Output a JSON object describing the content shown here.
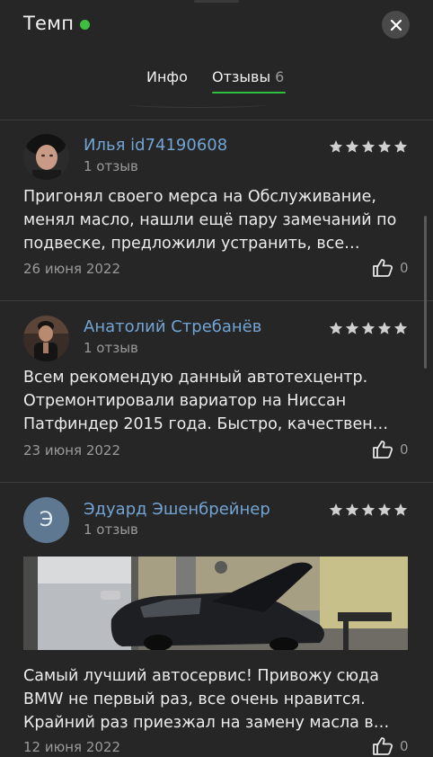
{
  "header": {
    "title": "Темп",
    "online_color": "#3fbf3f",
    "close_icon": "close-icon"
  },
  "tabs": {
    "info_label": "Инфо",
    "reviews_label": "Отзывы",
    "reviews_count": "6",
    "active": "reviews",
    "accent": "#2fbf3f"
  },
  "reviews": [
    {
      "author": "Илья id74190608",
      "sub": "1 отзыв",
      "rating": 5,
      "text": "Пригонял своего мерса на Обслуживание, менял масло, нашли ещё пару замечаний по подвеске, предложили устранить, все…",
      "date": "26 июня 2022",
      "likes": "0"
    },
    {
      "author": "Анатолий Стребанёв",
      "sub": "1 отзыв",
      "rating": 5,
      "text": "Всем рекомендую данный автотехцентр. Отремонтировали вариатор на Ниссан Патфиндер 2015 года. Быстро, качествен…",
      "date": "23 июня 2022",
      "likes": "0"
    },
    {
      "author": "Эдуард Эшенбрейнер",
      "avatar_letter": "Э",
      "sub": "1 отзыв",
      "rating": 5,
      "text": "Самый лучший автосервис! Привожу сюда BMW не первый раз, все очень нравится. Крайний раз приезжал на замену масла в…",
      "date": "12 июня 2022",
      "likes": "0"
    }
  ],
  "colors": {
    "background": "#262626",
    "author_link": "#72a4d4",
    "muted": "#9a9a9a",
    "star": "#cfcfcf"
  }
}
